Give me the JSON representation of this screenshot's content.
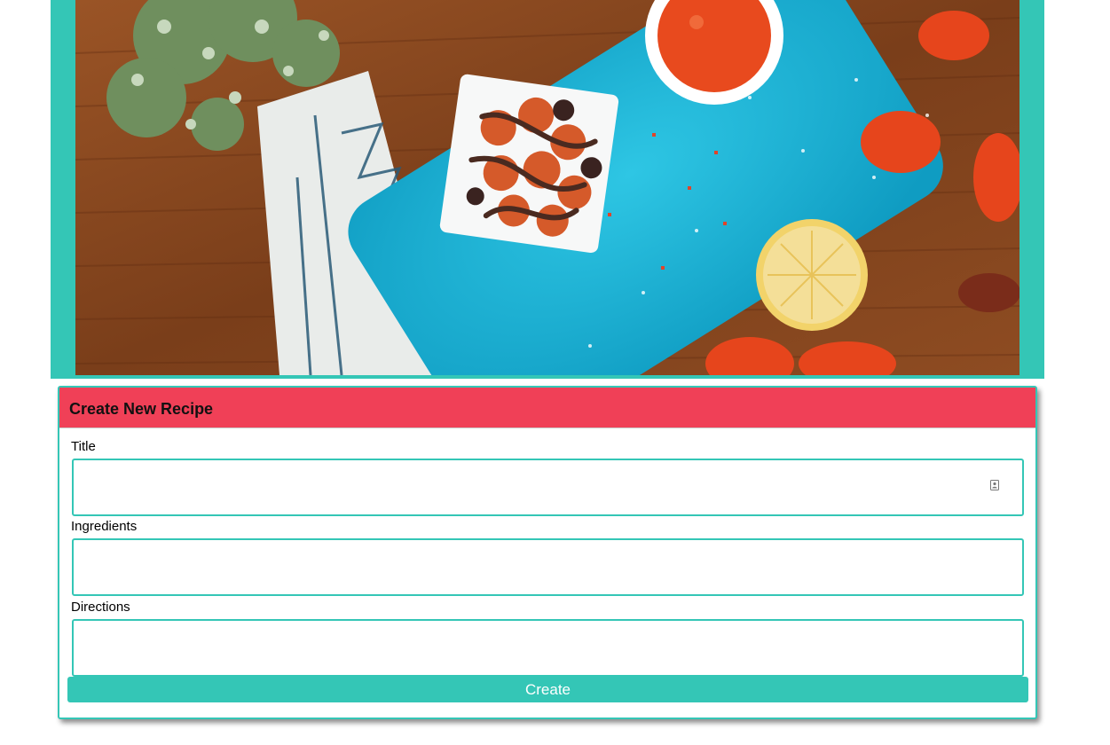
{
  "hero": {
    "image_name": "dessert-on-blue-plate-photo",
    "frame_color": "#34c6b6"
  },
  "form": {
    "title": "Create New Recipe",
    "header_color": "#f04057",
    "accent_color": "#34c6b6",
    "fields": [
      {
        "label": "Title",
        "value": "",
        "placeholder": ""
      },
      {
        "label": "Ingredients",
        "value": "",
        "placeholder": ""
      },
      {
        "label": "Directions",
        "value": "",
        "placeholder": ""
      }
    ],
    "title_field_icon": "autofill-contact-icon",
    "submit_label": "Create"
  }
}
